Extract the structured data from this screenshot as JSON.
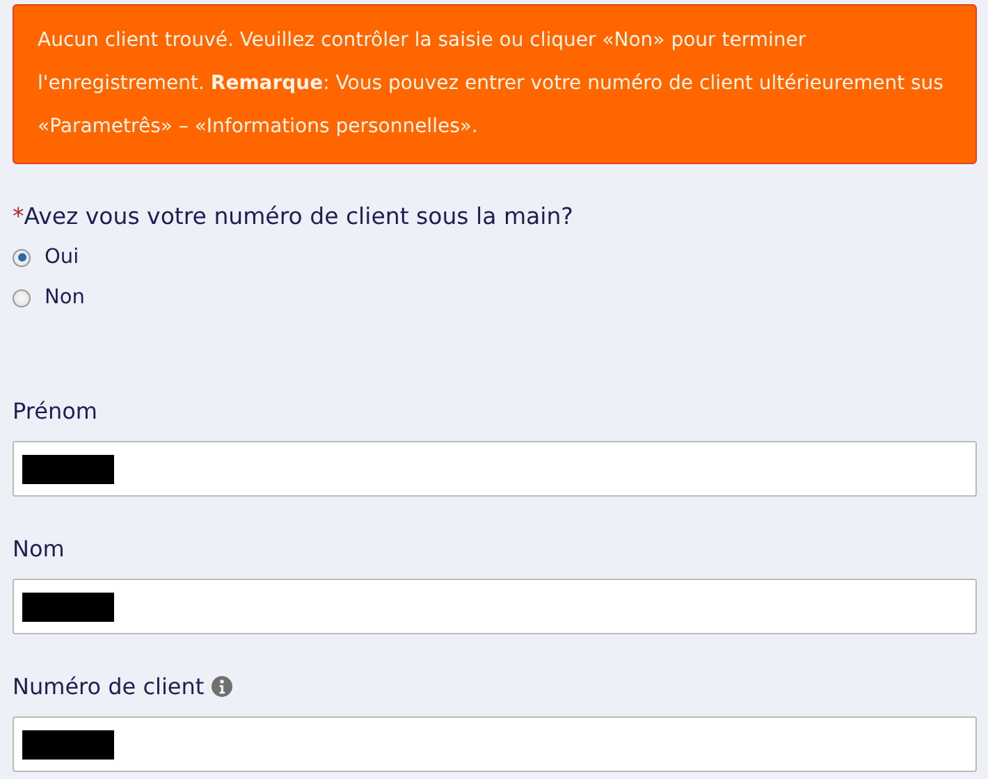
{
  "alert": {
    "text": "Aucun client trouvé. Veuillez contrôler la saisie ou cliquer «Non» pour terminer l'enregistrement. **Remarque**: Vous pouvez entrer votre numéro de client ultérieurement sus «Parametrês» – «Informations personnelles»."
  },
  "question": {
    "required_mark": "*",
    "label": "Avez vous votre numéro de client sous la main?",
    "options": [
      {
        "label": "Oui",
        "selected": true
      },
      {
        "label": "Non",
        "selected": false
      }
    ]
  },
  "fields": [
    {
      "label": "Prénom",
      "info": false,
      "redacted": true
    },
    {
      "label": "Nom",
      "info": false,
      "redacted": true
    },
    {
      "label": "Numéro de client",
      "info": true,
      "redacted": true
    }
  ]
}
